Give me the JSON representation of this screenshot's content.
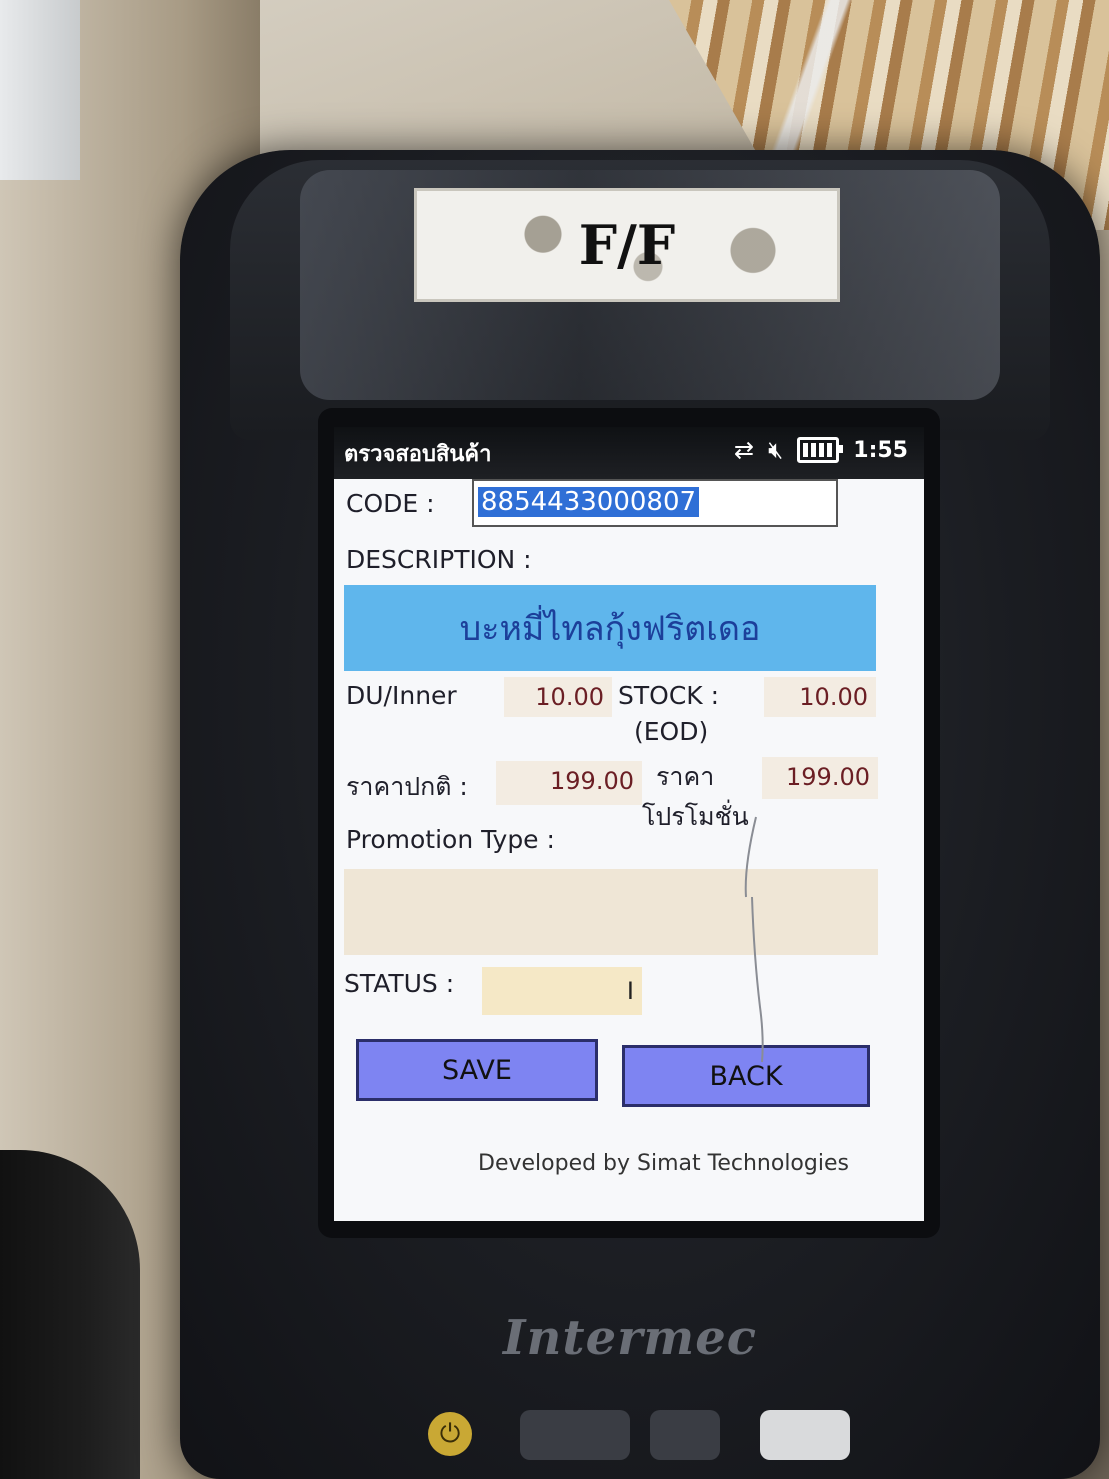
{
  "device": {
    "label": "F/F",
    "brand": "Intermec"
  },
  "titlebar": {
    "app_title": "ตรวจสอบสินค้า",
    "icons": [
      "connection-icon",
      "speaker-muted-icon",
      "battery-icon"
    ],
    "clock": "1:55"
  },
  "form": {
    "code_label": "CODE :",
    "code_value": "8854433000807",
    "description_label": "DESCRIPTION :",
    "description_value": "บะหมี่ไทลกุ้งฟริตเดอ",
    "du_inner_label": "DU/Inner",
    "du_inner_value": "10.00",
    "stock_label": "STOCK :",
    "stock_sub_label": "(EOD)",
    "stock_value": "10.00",
    "normal_price_label": "ราคาปกติ :",
    "normal_price_value": "199.00",
    "promo_price_label_1": "ราคา",
    "promo_price_label_2": "โปรโมชั่น",
    "promo_price_value": "199.00",
    "promotion_type_label": "Promotion Type :",
    "promotion_type_value": "",
    "status_label": "STATUS :",
    "status_value": "I"
  },
  "buttons": {
    "save_label": "SAVE",
    "back_label": "BACK"
  },
  "footer": {
    "credit": "Developed by Simat Technologies"
  },
  "colors": {
    "title_bar": "#16181c",
    "selection": "#2f6fd6",
    "description_bg": "#5fb6ec",
    "button_bg": "#7e84f2",
    "value_text": "#6b1e24"
  }
}
